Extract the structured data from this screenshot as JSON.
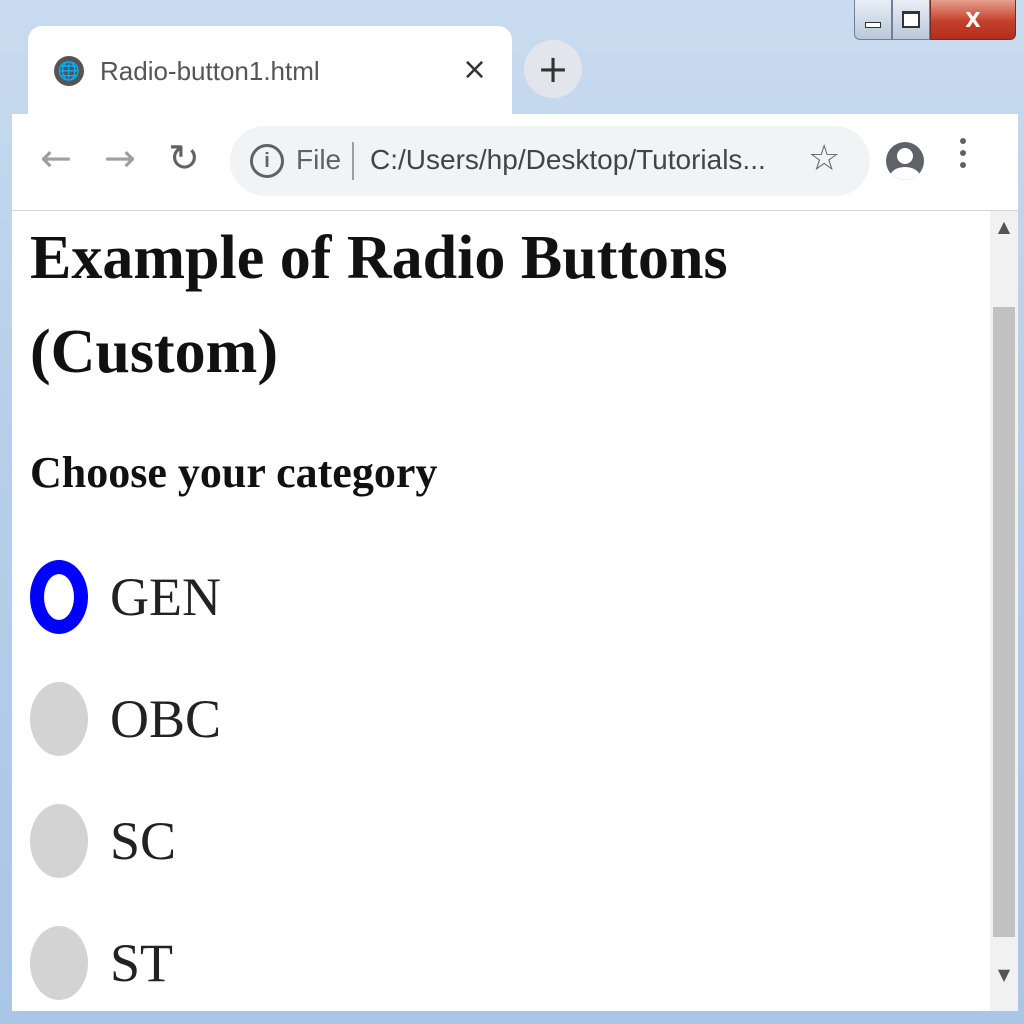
{
  "window": {
    "min_glyph": "",
    "max_glyph": "",
    "close_glyph": "X"
  },
  "tab": {
    "title": "Radio-button1.html",
    "close_glyph": "×",
    "favicon_glyph": "🌐",
    "new_tab_glyph": "+"
  },
  "toolbar": {
    "back_glyph": "←",
    "forward_glyph": "→",
    "reload_glyph": "↻",
    "info_glyph": "i",
    "scheme_label": "File",
    "url": "C:/Users/hp/Desktop/Tutorials...",
    "star_glyph": "☆"
  },
  "page": {
    "heading": "Example of Radio Buttons (Custom)",
    "subheading": "Choose your category",
    "options": [
      {
        "label": "GEN",
        "checked": true
      },
      {
        "label": "OBC",
        "checked": false
      },
      {
        "label": "SC",
        "checked": false
      },
      {
        "label": "ST",
        "checked": false
      }
    ]
  },
  "scrollbar": {
    "up_glyph": "▲",
    "down_glyph": "▼"
  },
  "colors": {
    "radio_checked": "#0000ff",
    "radio_unchecked": "#d3d3d3"
  }
}
